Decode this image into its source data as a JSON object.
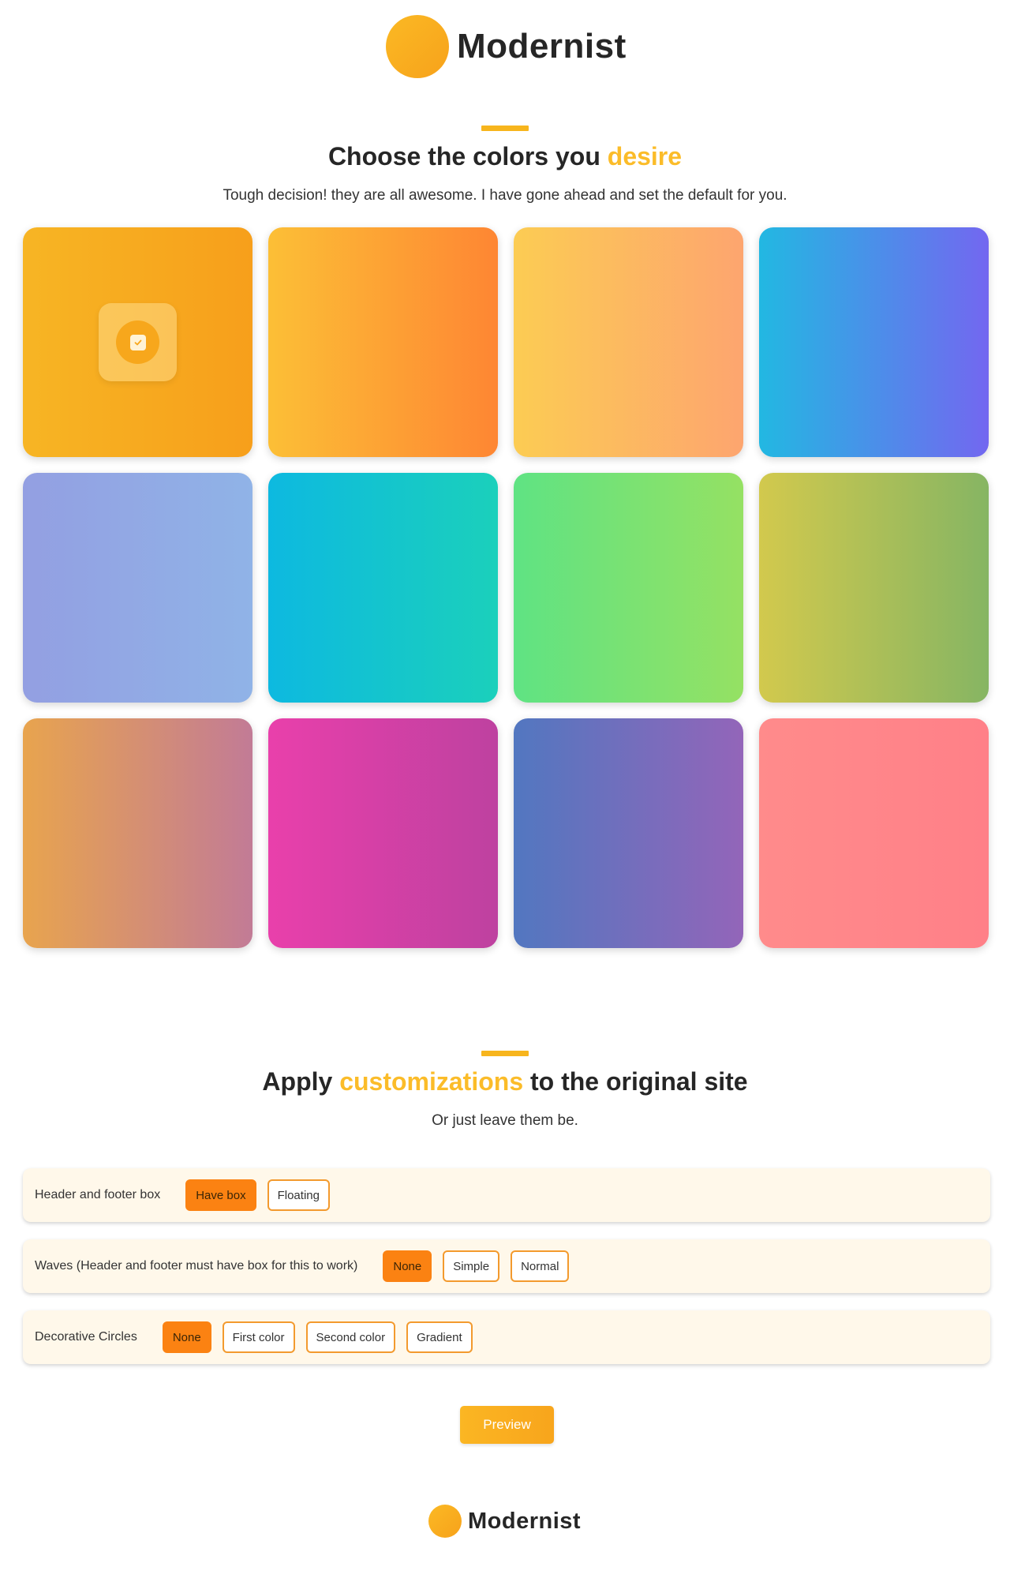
{
  "brand": {
    "name": "Modernist"
  },
  "colors_section": {
    "title_pre": "Choose the colors you ",
    "title_highlight": "desire",
    "subtitle": "Tough decision! they are all awesome. I have gone ahead and set the default for you.",
    "selected_index": 0,
    "swatches": [
      {
        "name": "swatch-1",
        "from": "#f7b524",
        "to": "#f79f1b"
      },
      {
        "name": "swatch-2",
        "from": "#fcbf36",
        "to": "#fe8633"
      },
      {
        "name": "swatch-3",
        "from": "#fccc53",
        "to": "#fda56f"
      },
      {
        "name": "swatch-4",
        "from": "#22b8e2",
        "to": "#7367f0"
      },
      {
        "name": "swatch-5",
        "from": "#939fe2",
        "to": "#90b3e7"
      },
      {
        "name": "swatch-6",
        "from": "#0db9e0",
        "to": "#1bd0bb"
      },
      {
        "name": "swatch-7",
        "from": "#5fe383",
        "to": "#95e163"
      },
      {
        "name": "swatch-8",
        "from": "#d2c94d",
        "to": "#86b563"
      },
      {
        "name": "swatch-9",
        "from": "#e8a44e",
        "to": "#c27b96"
      },
      {
        "name": "swatch-10",
        "from": "#e940ab",
        "to": "#be41a0"
      },
      {
        "name": "swatch-11",
        "from": "#5277c0",
        "to": "#9365b9"
      },
      {
        "name": "swatch-12",
        "from": "#ff8b8b",
        "to": "#ff8088"
      }
    ]
  },
  "custom_section": {
    "title_pre": "Apply ",
    "title_highlight": "customizations",
    "title_post": " to the original site",
    "subtitle": "Or just leave them be.",
    "options": [
      {
        "label": "Header and footer box",
        "choices": [
          "Have box",
          "Floating"
        ],
        "selected": "Have box"
      },
      {
        "label": "Waves (Header and footer must have box for this to work)",
        "choices": [
          "None",
          "Simple",
          "Normal"
        ],
        "selected": "None"
      },
      {
        "label": "Decorative Circles",
        "choices": [
          "None",
          "First color",
          "Second color",
          "Gradient"
        ],
        "selected": "None"
      }
    ],
    "preview_label": "Preview"
  },
  "colors": {
    "accent": "#fbbc29",
    "active_button": "#fb8212",
    "row_bg": "#fff8ea"
  },
  "icons": {
    "logo": "orange-circle-logo",
    "selected": "check-square-icon"
  }
}
